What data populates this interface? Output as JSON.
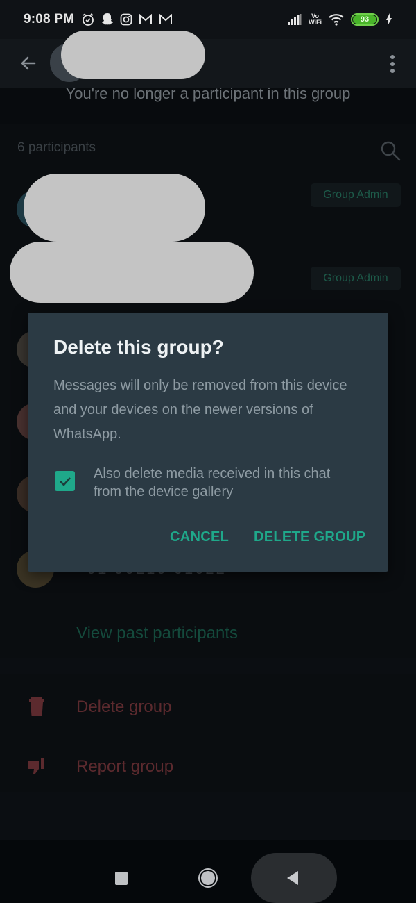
{
  "status_bar": {
    "time": "9:08 PM",
    "notification_icons": [
      "alarm-icon",
      "snapchat-icon",
      "instagram-icon",
      "gmail-icon",
      "gmail-icon"
    ],
    "vowifi_top": "Vo",
    "vowifi_bottom": "WiFi",
    "battery_percent": "93",
    "charging": true,
    "battery_color": "#49b52a"
  },
  "app_bar": {
    "back_icon": "arrow-left-icon",
    "group_name": "[redacted]",
    "menu_icon": "more-vert-icon"
  },
  "notice": "You're no longer a participant in this group",
  "participants": {
    "count_label": "6 participants",
    "search_icon": "search-icon",
    "badges": [
      "Group Admin",
      "Group Admin"
    ],
    "partial_row_text": "+91 90210 01022",
    "view_past_label": "View past participants"
  },
  "actions": [
    {
      "icon": "trash-icon",
      "label": "Delete group"
    },
    {
      "icon": "thumbs-down-icon",
      "label": "Report group"
    }
  ],
  "dialog": {
    "title": "Delete this group?",
    "body": "Messages will only be removed from this device and your devices on the newer versions of WhatsApp.",
    "checkbox_label": "Also delete media received in this chat from the device gallery",
    "checkbox_checked": true,
    "cancel_label": "CANCEL",
    "confirm_label": "DELETE GROUP",
    "accent_color": "#1fa88a"
  },
  "nav_bar": {
    "recents": "recents-icon",
    "home": "home-icon",
    "back": "back-triangle-icon"
  }
}
